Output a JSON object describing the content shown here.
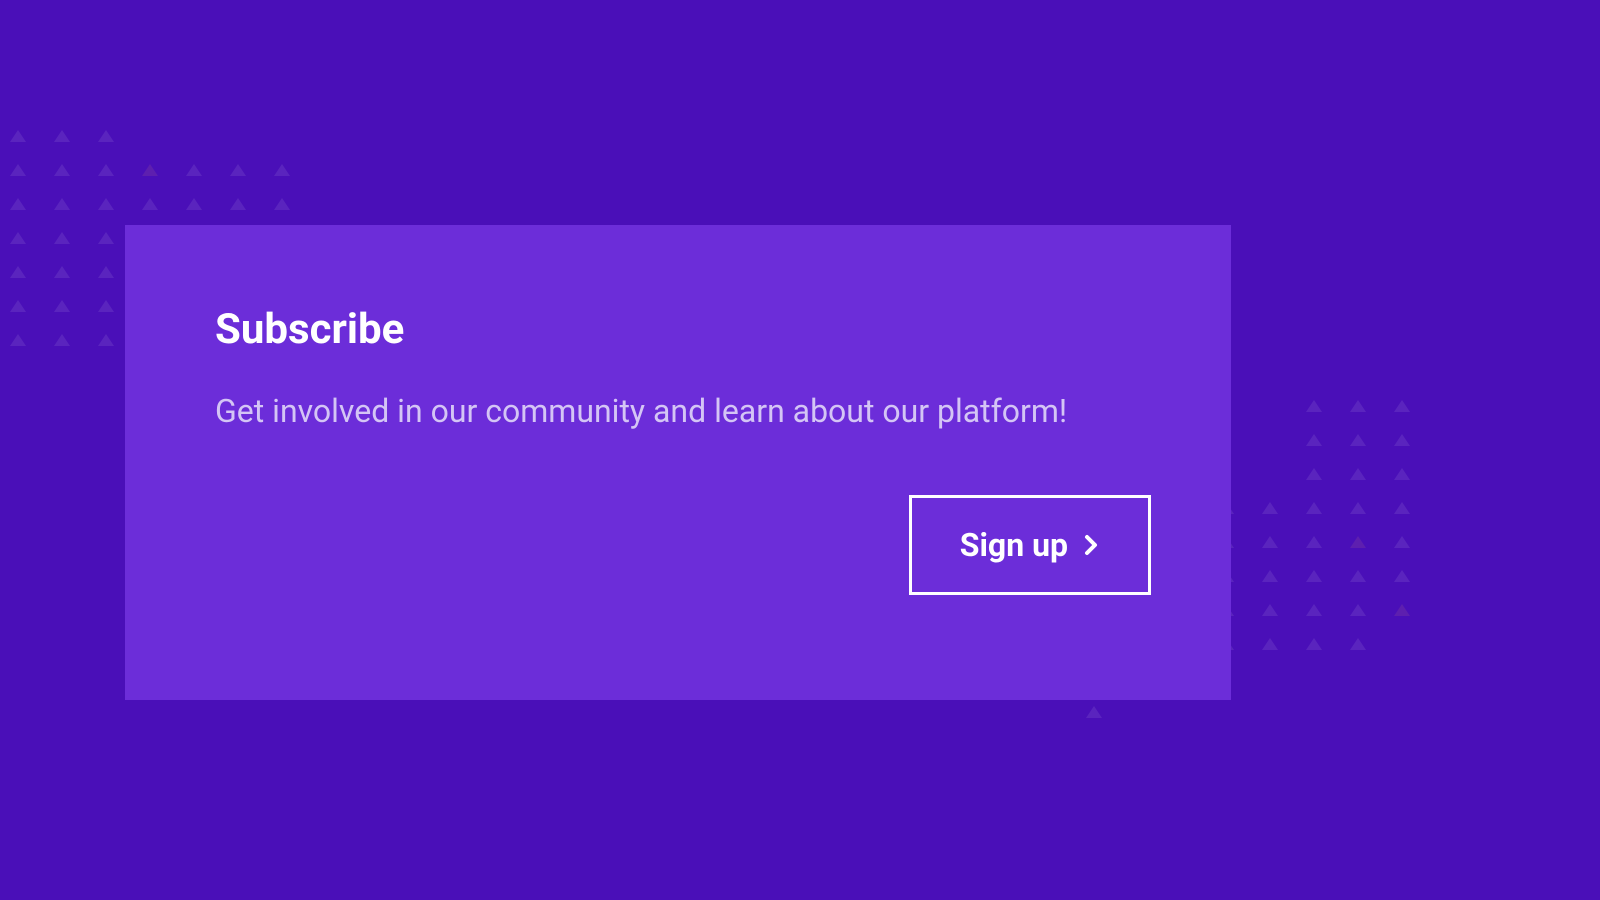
{
  "card": {
    "title": "Subscribe",
    "description": "Get involved in our community and learn about our platform!",
    "button_label": "Sign up"
  },
  "colors": {
    "background": "#4a0fb8",
    "card_background": "#6c2dd9",
    "text_primary": "#ffffff",
    "text_secondary": "#d4c5f5"
  }
}
